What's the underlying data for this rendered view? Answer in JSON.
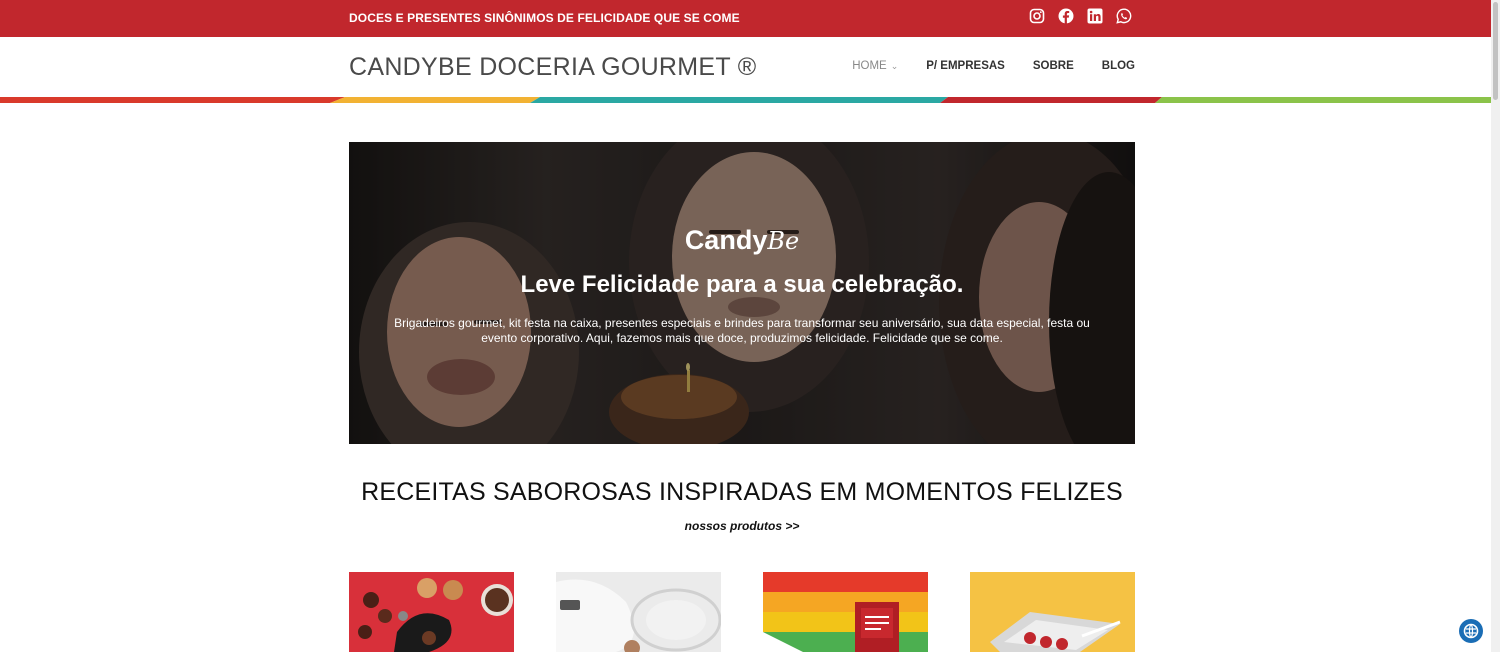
{
  "topbar": {
    "tagline": "DOCES E PRESENTES SINÔNIMOS DE FELICIDADE QUE SE COME",
    "background": "#c1272d",
    "social_icons": [
      "instagram-icon",
      "facebook-icon",
      "linkedin-icon",
      "whatsapp-icon"
    ]
  },
  "header": {
    "brand": "CANDYBE DOCERIA GOURMET ®",
    "nav": [
      {
        "label": "HOME",
        "has_dropdown": true
      },
      {
        "label": "P/ EMPRESAS"
      },
      {
        "label": "SOBRE"
      },
      {
        "label": "BLOG"
      }
    ]
  },
  "stripe_colors": [
    "#d93a2b",
    "#f2b233",
    "#2aa8a3",
    "#c1272d",
    "#8bc34a"
  ],
  "hero": {
    "logo_main": "Candy",
    "logo_script": "Be",
    "title": "Leve Felicidade para a sua celebração.",
    "text": "Brigadeiros gourmet, kit festa na caixa, presentes especiais e brindes para transformar seu aniversário, sua data especial, festa ou evento corporativo. Aqui, fazemos mais que doce, produzimos felicidade. Felicidade que se come."
  },
  "section": {
    "title": "RECEITAS SABOROSAS INSPIRADAS EM MOMENTOS FELIZES",
    "link": "nossos produtos >>"
  },
  "products": [
    {
      "name": "product-image-brigadeiros",
      "bg": "#d8303a"
    },
    {
      "name": "product-image-gift-box",
      "bg": "#e8e8e8"
    },
    {
      "name": "product-image-felicidade-pack",
      "bg": "#e53a2a"
    },
    {
      "name": "product-image-kit-festa",
      "bg": "#f5c244"
    }
  ]
}
